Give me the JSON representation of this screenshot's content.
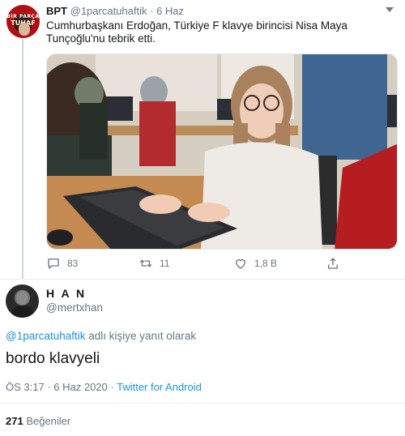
{
  "tweet": {
    "author_name": "BPT",
    "author_handle": "@1parcatuhaftik",
    "dot": "·",
    "time": "6 Haz",
    "text": "Cumhurbaşkanı Erdoğan, Türkiye F klavye birincisi Nisa Maya Tunçoğlu'nu tebrik etti.",
    "avatar_text_top": "BİR PARÇA",
    "avatar_text_bottom": "TUHAF",
    "reply_count": "83",
    "retweet_count": "11",
    "like_count": "1,8 B",
    "icons": {
      "reply": "comment-icon",
      "retweet": "retweet-icon",
      "like": "heart-icon",
      "share": "share-icon",
      "menu": "chevron-down-icon"
    }
  },
  "reply": {
    "author_name": "H A N",
    "author_handle": "@mertxhan",
    "replying_mention": "@1parcatuhaftik",
    "replying_suffix": " adlı kişiye yanıt olarak",
    "text": "bordo klavyeli",
    "time": "ÖS 3:17",
    "dot": " · ",
    "date": "6 Haz 2020",
    "dot2": " · ",
    "source": "Twitter for Android",
    "likes_count": "271",
    "likes_label": " Beğeniler"
  },
  "colors": {
    "link": "#1b95e0",
    "muted": "#657786",
    "text": "#14171a",
    "thread": "#ccd6dd"
  }
}
